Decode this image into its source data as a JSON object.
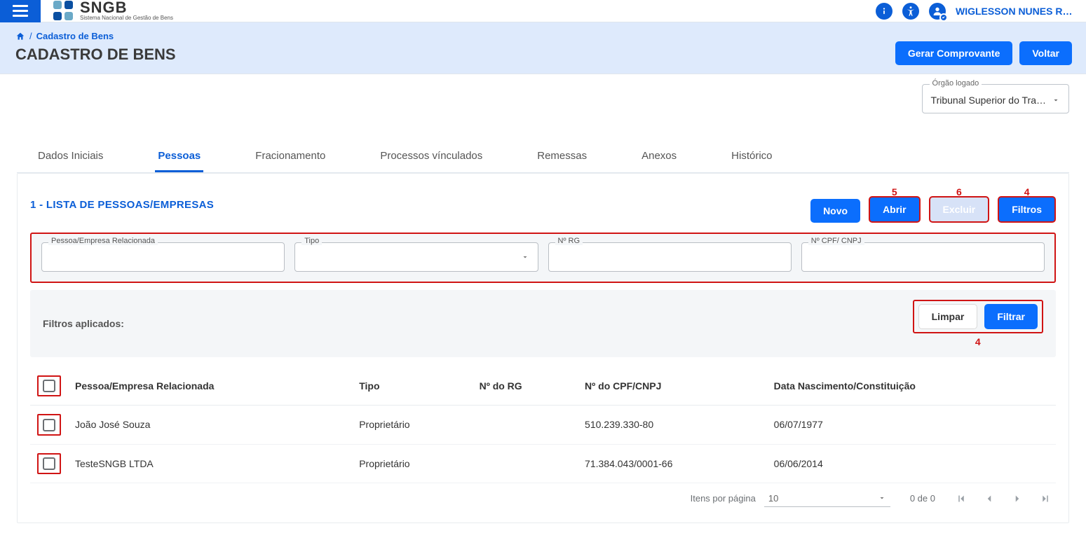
{
  "brand": {
    "name": "SNGB",
    "subtitle": "Sistema Nacional de Gestão de Bens"
  },
  "header": {
    "user": "WIGLESSON NUNES RO…"
  },
  "breadcrumb": {
    "item": "Cadastro de Bens"
  },
  "page": {
    "title": "CADASTRO DE BENS",
    "actions": {
      "gerar": "Gerar Comprovante",
      "voltar": "Voltar"
    },
    "org_label": "Órgão logado",
    "org_value": "Tribunal Superior do Tra…"
  },
  "tabs": {
    "items": [
      {
        "label": "Dados Iniciais"
      },
      {
        "label": "Pessoas"
      },
      {
        "label": "Fracionamento"
      },
      {
        "label": "Processos vínculados"
      },
      {
        "label": "Remessas"
      },
      {
        "label": "Anexos"
      },
      {
        "label": "Histórico"
      }
    ],
    "activeIndex": 1
  },
  "section": {
    "title": "1 - LISTA DE PESSOAS/EMPRESAS",
    "buttons": {
      "novo": "Novo",
      "abrir": "Abrir",
      "excluir": "Excluir",
      "filtros": "Filtros"
    }
  },
  "filters": {
    "labels": {
      "pessoa": "Pessoa/Empresa Relacionada",
      "tipo": "Tipo",
      "rg": "Nº RG",
      "cpf": "Nº CPF/ CNPJ"
    },
    "applied_label": "Filtros aplicados:",
    "actions": {
      "limpar": "Limpar",
      "filtrar": "Filtrar"
    }
  },
  "table": {
    "columns": {
      "pessoa": "Pessoa/Empresa Relacionada",
      "tipo": "Tipo",
      "rg": "Nº do RG",
      "cpf": "Nº do CPF/CNPJ",
      "nasc": "Data Nascimento/Constituição"
    },
    "rows": [
      {
        "pessoa": "João José Souza",
        "tipo": "Proprietário",
        "rg": "",
        "cpf": "510.239.330-80",
        "nasc": "06/07/1977"
      },
      {
        "pessoa": "TesteSNGB LTDA",
        "tipo": "Proprietário",
        "rg": "",
        "cpf": "71.384.043/0001-66",
        "nasc": "06/06/2014"
      }
    ]
  },
  "pager": {
    "perpage_label": "Itens por página",
    "perpage_value": "10",
    "range": "0 de 0"
  },
  "annotations": {
    "filtros": "4",
    "abrir": "5",
    "excluir": "6",
    "filtrar_below": "4"
  }
}
